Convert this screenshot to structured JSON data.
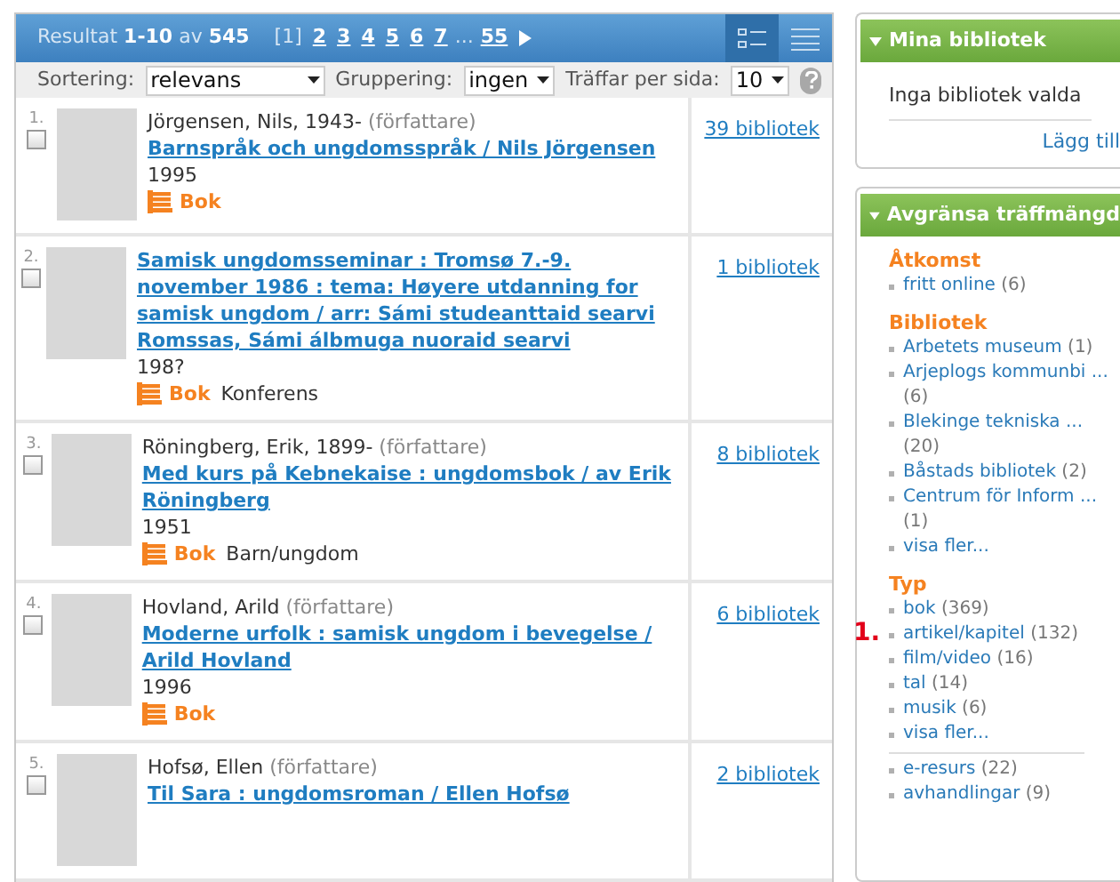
{
  "results_bar": {
    "summary": "Resultat **1-10** av **545**",
    "pages": [
      {
        "label": "[1]",
        "selected": true
      },
      {
        "label": "2",
        "selected": false
      },
      {
        "label": "3",
        "selected": false
      },
      {
        "label": "4",
        "selected": false
      },
      {
        "label": "5",
        "selected": false
      },
      {
        "label": "6",
        "selected": false
      },
      {
        "label": "7",
        "selected": false
      },
      {
        "label": "55",
        "selected": false
      }
    ],
    "gap_after": "...",
    "views": [
      {
        "kind": "detail",
        "selected": true
      },
      {
        "kind": "list",
        "selected": false
      }
    ]
  },
  "toolbar": {
    "controls": [
      {
        "label": "Sortering:",
        "value": "relevans"
      },
      {
        "label": "Gruppering:",
        "value": "ingen"
      },
      {
        "label": "Träffar per sida:",
        "value": "10"
      }
    ]
  },
  "results": [
    {
      "number": "1.",
      "checked": false,
      "author": "Jörgensen, Nils, 1943-",
      "role": "(författare)",
      "title": "Barnspråk och ungdomsspråk / Nils Jörgensen",
      "year": "1995",
      "type": "Bok",
      "libraries": "39 bibliotek"
    },
    {
      "number": "2.",
      "checked": false,
      "title": "Samisk ungdomsseminar : Tromsø 7.-9. november 1986 : tema: Høyere utdanning for samisk ungdom / arr: Sámi studeanttaid searvi Romssas, Sámi álbmuga nuoraid searvi",
      "year": "198?",
      "type": "Bok",
      "genre": "Konferens",
      "libraries": "1 bibliotek"
    },
    {
      "number": "3.",
      "checked": false,
      "author": "Röningberg, Erik, 1899-",
      "role": "(författare)",
      "title": "Med kurs på Kebnekaise : ungdomsbok / av Erik Röningberg",
      "year": "1951",
      "type": "Bok",
      "genre": "Barn/ungdom",
      "libraries": "8 bibliotek"
    },
    {
      "number": "4.",
      "checked": false,
      "author": "Hovland, Arild",
      "role": "(författare)",
      "title": "Moderne urfolk : samisk ungdom i bevegelse / Arild Hovland",
      "year": "1996",
      "type": "Bok",
      "libraries": "6 bibliotek"
    },
    {
      "number": "5.",
      "checked": false,
      "author": "Hofsø, Ellen",
      "role": "(författare)",
      "title": "Til Sara : ungdomsroman / Ellen Hofsø",
      "libraries": "2 bibliotek"
    }
  ],
  "my_libraries": {
    "title": "Mina bibliotek",
    "empty": "Inga bibliotek valda",
    "add": "Lägg till"
  },
  "refine": {
    "title": "Avgränsa träffmängd",
    "groups": [
      {
        "heading": "Åtkomst",
        "items": [
          {
            "label": "fritt online",
            "count": "(6)"
          }
        ]
      },
      {
        "heading": "Bibliotek",
        "items": [
          {
            "label": "Arbetets museum",
            "count": "(1)"
          },
          {
            "label": "Arjeplogs kommunbi ...",
            "count": "(6)"
          },
          {
            "label": "Blekinge tekniska ...",
            "count": "(20)"
          },
          {
            "label": "Båstads bibliotek",
            "count": "(2)"
          },
          {
            "label": "Centrum för Inform ...",
            "count": "(1)"
          },
          {
            "label": "visa fler..."
          }
        ]
      },
      {
        "heading": "Typ",
        "items": [
          {
            "label": "bok",
            "count": "(369)"
          },
          {
            "label": "artikel/kapitel",
            "count": "(132)",
            "marker": "1."
          },
          {
            "label": "film/video",
            "count": "(16)"
          },
          {
            "label": "tal",
            "count": "(14)"
          },
          {
            "label": "musik",
            "count": "(6)"
          },
          {
            "label": "visa fler..."
          }
        ],
        "extra_items": [
          {
            "label": "e-resurs",
            "count": "(22)"
          },
          {
            "label": "avhandlingar",
            "count": "(9)"
          }
        ]
      }
    ]
  }
}
